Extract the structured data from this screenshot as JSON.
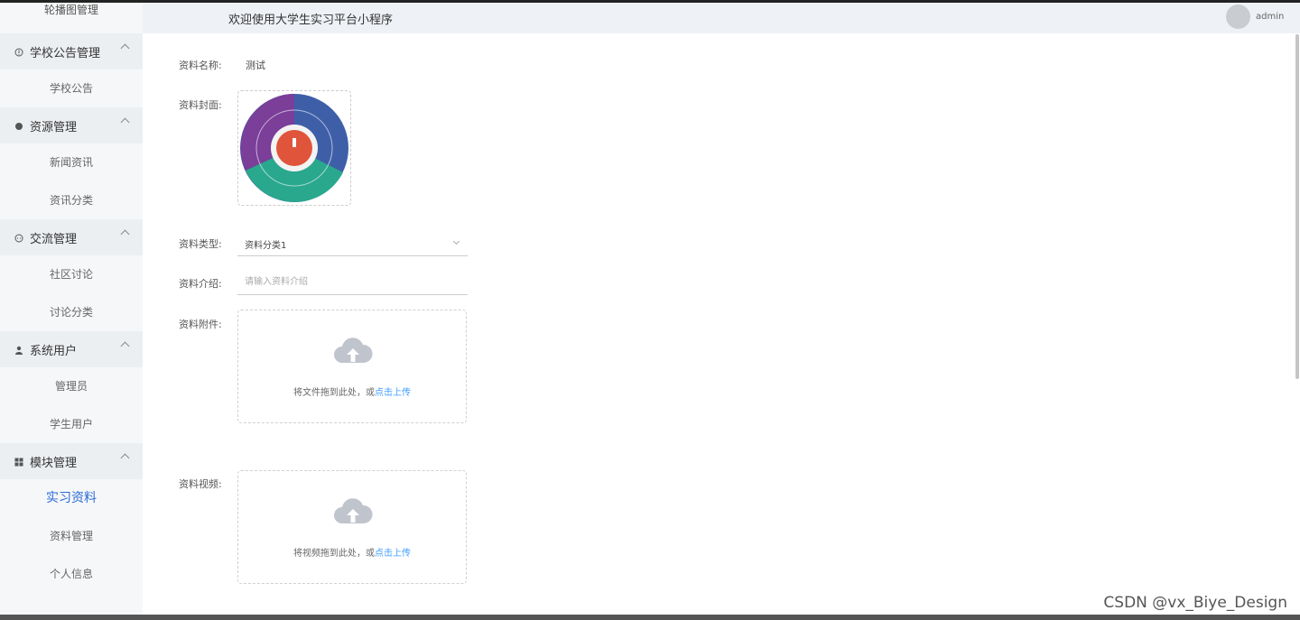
{
  "header": {
    "title": "欢迎使用大学生实习平台小程序",
    "username": "admin"
  },
  "sidebar": {
    "top_item": "轮播图管理",
    "groups": [
      {
        "label": "学校公告管理",
        "icon": "info-circle-icon",
        "items": [
          "学校公告"
        ]
      },
      {
        "label": "资源管理",
        "icon": "drop-icon",
        "items": [
          "新闻资讯",
          "资讯分类"
        ]
      },
      {
        "label": "交流管理",
        "icon": "chat-bubble-icon",
        "items": [
          "社区讨论",
          "讨论分类"
        ]
      },
      {
        "label": "系统用户",
        "icon": "user-icon",
        "items": [
          "管理员",
          "学生用户"
        ]
      },
      {
        "label": "模块管理",
        "icon": "grid-icon",
        "items": [
          "实习资料",
          "资料管理",
          "个人信息"
        ]
      }
    ]
  },
  "form": {
    "name_label": "资料名称:",
    "name_value": "测试",
    "cover_label": "资料封面:",
    "type_label": "资料类型:",
    "type_value": "资料分类1",
    "intro_label": "资料介绍:",
    "intro_placeholder": "请输入资料介绍",
    "attachment_label": "资料附件:",
    "attachment_text": "将文件拖到此处，或",
    "attachment_link": "点击上传",
    "video_label": "资料视频:",
    "video_text": "将视频拖到此处，或",
    "video_link": "点击上传"
  },
  "watermark": "CSDN @vx_Biye_Design",
  "colors": {
    "accent": "#409eff",
    "selected_menu": "#2d6bd6",
    "sidebar_bg": "#f5f7f9"
  }
}
